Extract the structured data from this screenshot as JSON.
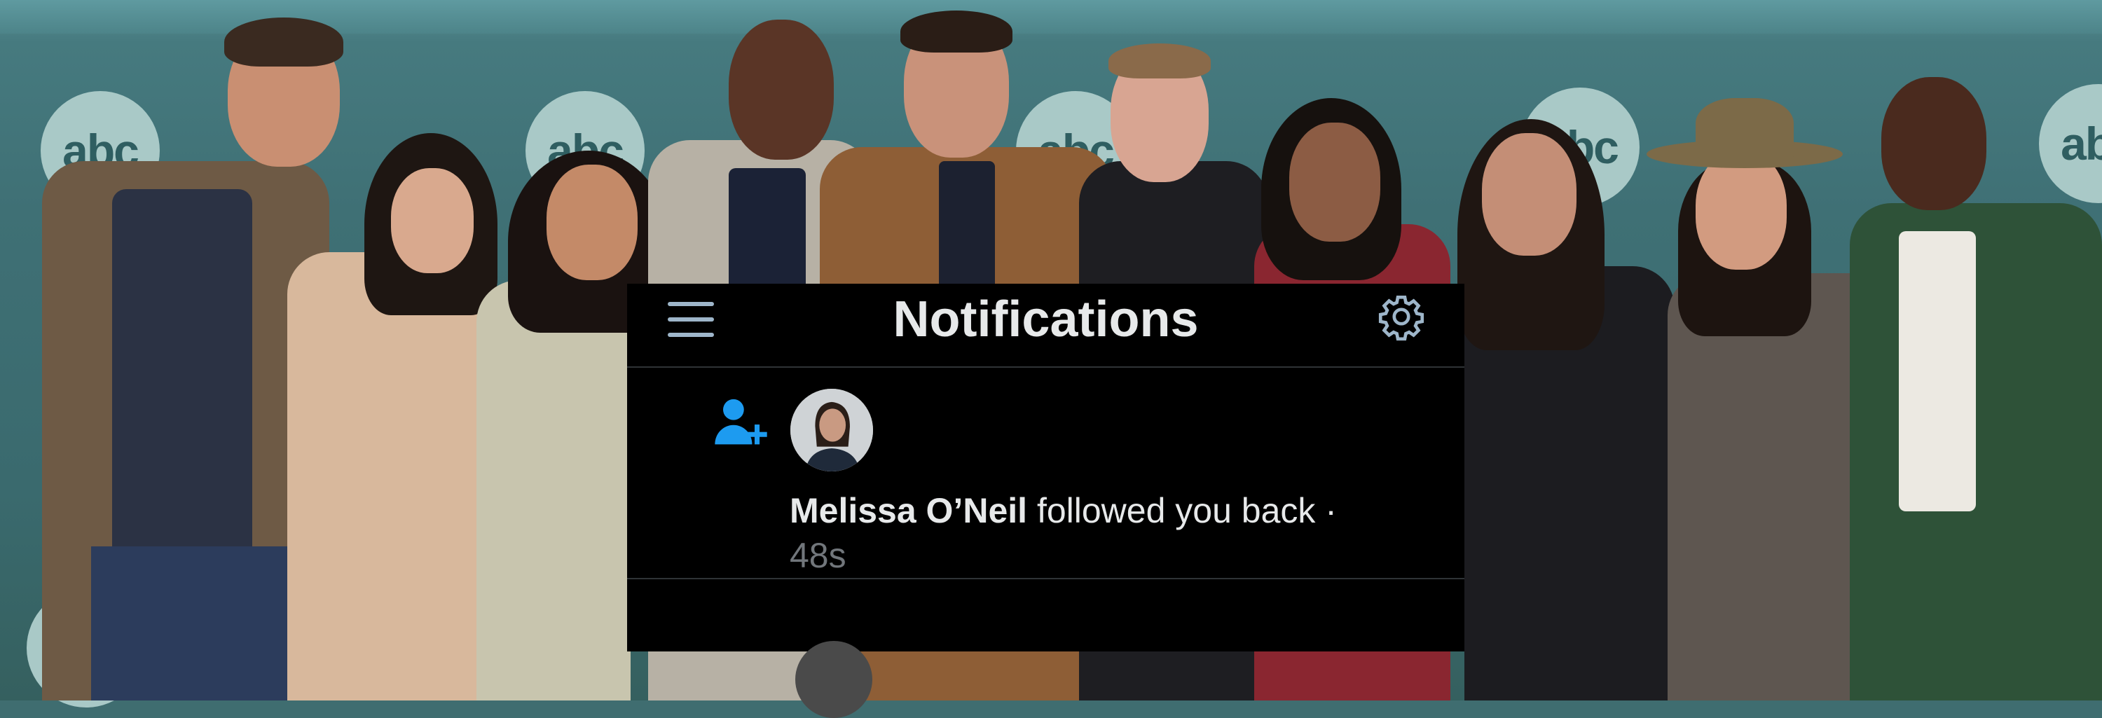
{
  "backdrop": {
    "logo_text": "abc",
    "colors": {
      "wall": "#3f7075",
      "logo": "#a9c9c7",
      "logo_text": "#2f5e61"
    }
  },
  "notifications": {
    "title": "Notifications",
    "menu_icon": "hamburger-menu-icon",
    "settings_icon": "gear-icon",
    "items": [
      {
        "icon": "person-add-icon",
        "user_name": "Melissa O’Neil",
        "action": " followed you back · ",
        "time": "48s"
      }
    ],
    "colors": {
      "panel": "#000000",
      "accent": "#1d9bf0",
      "text": "#e7e9ea",
      "muted": "#71767b"
    }
  }
}
